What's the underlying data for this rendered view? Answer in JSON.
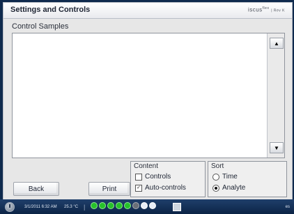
{
  "window": {
    "title": "Settings and Controls",
    "brand": "iscus",
    "brand_sup": "flex",
    "brand_rev": "| Rev K"
  },
  "section": {
    "label": "Control Samples"
  },
  "list": {
    "items": [],
    "scroll_up_icon": "triangle-up",
    "scroll_down_icon": "triangle-down"
  },
  "buttons": {
    "back": "Back",
    "print": "Print"
  },
  "content_group": {
    "title": "Content",
    "options": [
      {
        "label": "Controls",
        "checked": false
      },
      {
        "label": "Auto-controls",
        "checked": true
      }
    ]
  },
  "sort_group": {
    "title": "Sort",
    "options": [
      {
        "label": "Time",
        "selected": false
      },
      {
        "label": "Analyte",
        "selected": true
      }
    ]
  },
  "status": {
    "date": "3/1/2011 6:32 AM",
    "temperature": "25.3 °C",
    "separator": "|",
    "right_text": "es",
    "accent_green": "#26c12a"
  }
}
